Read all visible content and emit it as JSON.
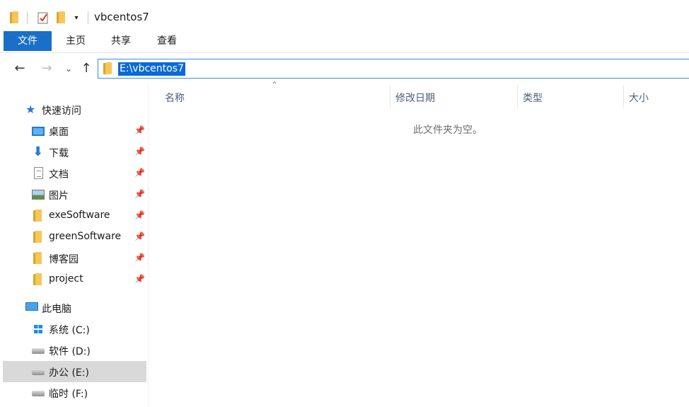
{
  "window": {
    "title": "vbcentos7"
  },
  "quick_access_toolbar": {
    "icons": [
      "folder-icon",
      "properties-icon",
      "new-folder-icon",
      "customize-dropdown-icon"
    ]
  },
  "ribbon": {
    "tabs": [
      {
        "id": "file",
        "label": "文件",
        "active": true
      },
      {
        "id": "home",
        "label": "主页"
      },
      {
        "id": "share",
        "label": "共享"
      },
      {
        "id": "view",
        "label": "查看"
      }
    ]
  },
  "address": {
    "path": "E:\\vbcentos7"
  },
  "nav": {
    "quick_access_label": "快速访问",
    "quick_access_items": [
      {
        "label": "桌面",
        "icon": "desktop-icon",
        "pinned": true
      },
      {
        "label": "下载",
        "icon": "download-icon",
        "pinned": true
      },
      {
        "label": "文档",
        "icon": "documents-icon",
        "pinned": true
      },
      {
        "label": "图片",
        "icon": "pictures-icon",
        "pinned": true
      },
      {
        "label": "exeSoftware",
        "icon": "folder-icon",
        "pinned": true
      },
      {
        "label": "greenSoftware",
        "icon": "folder-icon",
        "pinned": true
      },
      {
        "label": "博客园",
        "icon": "folder-icon",
        "pinned": true
      },
      {
        "label": "project",
        "icon": "folder-icon",
        "pinned": true
      }
    ],
    "this_pc_label": "此电脑",
    "drives": [
      {
        "label": "系统 (C:)",
        "icon": "windows-drive-icon"
      },
      {
        "label": "软件 (D:)",
        "icon": "drive-icon"
      },
      {
        "label": "办公 (E:)",
        "icon": "drive-icon",
        "selected": true
      },
      {
        "label": "临时 (F:)",
        "icon": "drive-icon"
      }
    ]
  },
  "content": {
    "columns": [
      "名称",
      "修改日期",
      "类型",
      "大小"
    ],
    "sorted_by": "名称",
    "empty_message": "此文件夹为空。"
  },
  "colors": {
    "accent": "#1a6fc9",
    "selection": "#0a6ad6",
    "address_border": "#3a8ee6",
    "nav_selected": "#d9d9d9"
  }
}
